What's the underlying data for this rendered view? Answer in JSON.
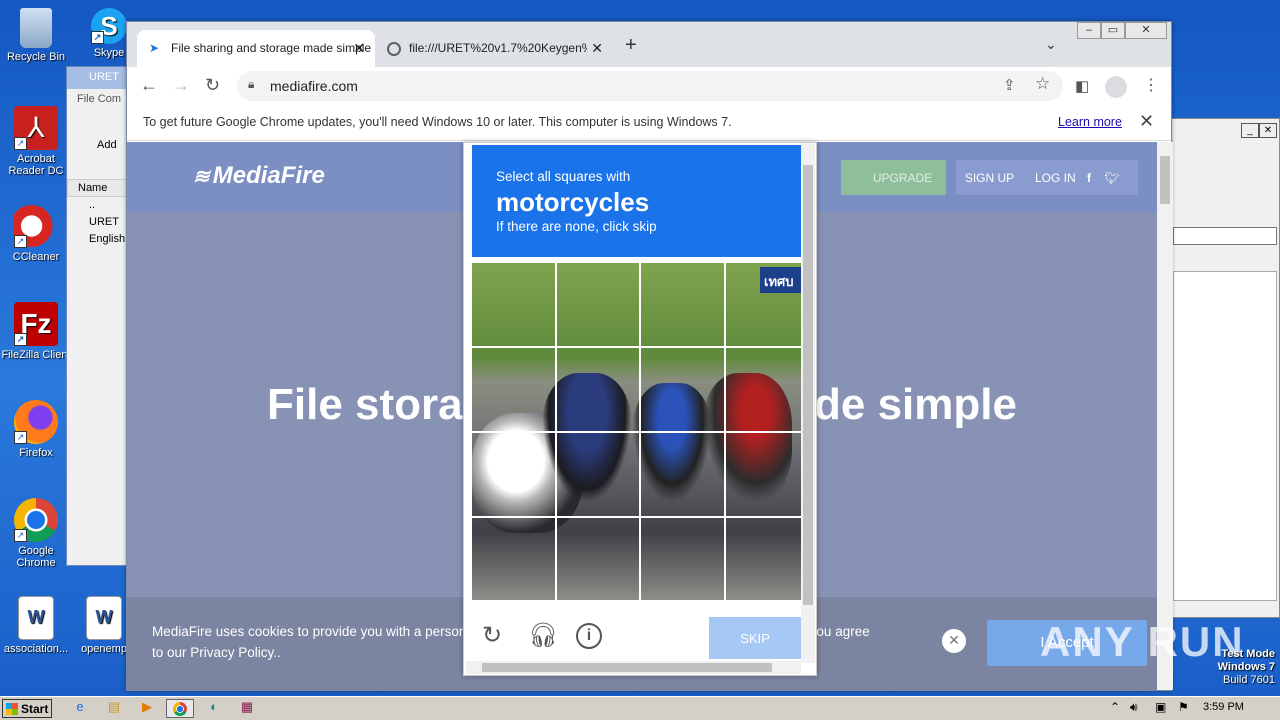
{
  "desktop": {
    "icons": [
      {
        "label": "Recycle Bin"
      },
      {
        "label": "Acrobat Reader DC"
      },
      {
        "label": "CCleaner"
      },
      {
        "label": "FileZilla Client"
      },
      {
        "label": "Firefox"
      },
      {
        "label": "Google Chrome"
      },
      {
        "label": "association..."
      },
      {
        "label": "openemp"
      },
      {
        "label": "Skype"
      }
    ]
  },
  "winrar": {
    "title": "URET",
    "menu": [
      "File",
      "Com"
    ],
    "add_label": "Add",
    "col_name": "Name",
    "rows": [
      "..",
      "URET",
      "English"
    ]
  },
  "browser": {
    "tabs": [
      {
        "title": "File sharing and storage made simple",
        "active": true
      },
      {
        "title": "file:///URET%20v1.7%20Keygen%",
        "active": false
      }
    ],
    "url": "mediafire.com",
    "infobar_text": "To get future Google Chrome updates, you'll need Windows 10 or later. This computer is using Windows 7.",
    "infobar_link": "Learn more"
  },
  "mediafire": {
    "logo": "MediaFire",
    "upgrade": "UPGRADE",
    "signup": "SIGN UP",
    "login": "LOG IN",
    "hero_left": "File storag",
    "hero_right": "ade simple",
    "cookie_line1_left": "MediaFire uses cookies to provide you with a person",
    "cookie_line1_right": "ou agree",
    "cookie_line2": "to our Privacy Policy..",
    "accept": "I Accept"
  },
  "captcha": {
    "instruction": "Select all squares with",
    "target": "motorcycles",
    "subtext": "If there are none, click skip",
    "skip": "SKIP",
    "grid_rows": 4,
    "grid_cols": 4,
    "sign_text": "เทศบ"
  },
  "taskbar": {
    "start": "Start",
    "clock": "3:59 PM"
  },
  "watermark": {
    "test_mode": "Test Mode",
    "os": "Windows 7",
    "build": "Build 7601",
    "brand": "ANY RUN"
  }
}
